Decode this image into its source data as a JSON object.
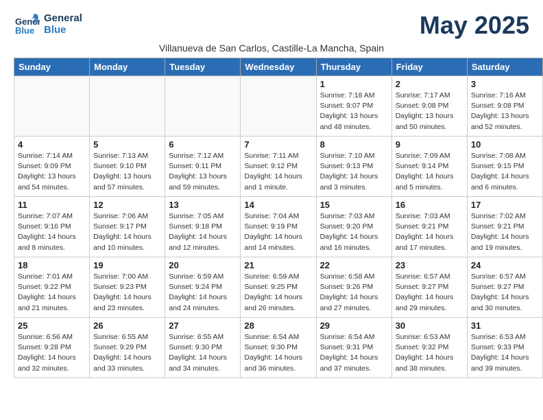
{
  "header": {
    "logo_line1": "General",
    "logo_line2": "Blue",
    "month_title": "May 2025",
    "subtitle": "Villanueva de San Carlos, Castille-La Mancha, Spain"
  },
  "days_of_week": [
    "Sunday",
    "Monday",
    "Tuesday",
    "Wednesday",
    "Thursday",
    "Friday",
    "Saturday"
  ],
  "weeks": [
    [
      {
        "day": "",
        "info": ""
      },
      {
        "day": "",
        "info": ""
      },
      {
        "day": "",
        "info": ""
      },
      {
        "day": "",
        "info": ""
      },
      {
        "day": "1",
        "info": "Sunrise: 7:18 AM\nSunset: 9:07 PM\nDaylight: 13 hours\nand 48 minutes."
      },
      {
        "day": "2",
        "info": "Sunrise: 7:17 AM\nSunset: 9:08 PM\nDaylight: 13 hours\nand 50 minutes."
      },
      {
        "day": "3",
        "info": "Sunrise: 7:16 AM\nSunset: 9:08 PM\nDaylight: 13 hours\nand 52 minutes."
      }
    ],
    [
      {
        "day": "4",
        "info": "Sunrise: 7:14 AM\nSunset: 9:09 PM\nDaylight: 13 hours\nand 54 minutes."
      },
      {
        "day": "5",
        "info": "Sunrise: 7:13 AM\nSunset: 9:10 PM\nDaylight: 13 hours\nand 57 minutes."
      },
      {
        "day": "6",
        "info": "Sunrise: 7:12 AM\nSunset: 9:11 PM\nDaylight: 13 hours\nand 59 minutes."
      },
      {
        "day": "7",
        "info": "Sunrise: 7:11 AM\nSunset: 9:12 PM\nDaylight: 14 hours\nand 1 minute."
      },
      {
        "day": "8",
        "info": "Sunrise: 7:10 AM\nSunset: 9:13 PM\nDaylight: 14 hours\nand 3 minutes."
      },
      {
        "day": "9",
        "info": "Sunrise: 7:09 AM\nSunset: 9:14 PM\nDaylight: 14 hours\nand 5 minutes."
      },
      {
        "day": "10",
        "info": "Sunrise: 7:08 AM\nSunset: 9:15 PM\nDaylight: 14 hours\nand 6 minutes."
      }
    ],
    [
      {
        "day": "11",
        "info": "Sunrise: 7:07 AM\nSunset: 9:16 PM\nDaylight: 14 hours\nand 8 minutes."
      },
      {
        "day": "12",
        "info": "Sunrise: 7:06 AM\nSunset: 9:17 PM\nDaylight: 14 hours\nand 10 minutes."
      },
      {
        "day": "13",
        "info": "Sunrise: 7:05 AM\nSunset: 9:18 PM\nDaylight: 14 hours\nand 12 minutes."
      },
      {
        "day": "14",
        "info": "Sunrise: 7:04 AM\nSunset: 9:19 PM\nDaylight: 14 hours\nand 14 minutes."
      },
      {
        "day": "15",
        "info": "Sunrise: 7:03 AM\nSunset: 9:20 PM\nDaylight: 14 hours\nand 16 minutes."
      },
      {
        "day": "16",
        "info": "Sunrise: 7:03 AM\nSunset: 9:21 PM\nDaylight: 14 hours\nand 17 minutes."
      },
      {
        "day": "17",
        "info": "Sunrise: 7:02 AM\nSunset: 9:21 PM\nDaylight: 14 hours\nand 19 minutes."
      }
    ],
    [
      {
        "day": "18",
        "info": "Sunrise: 7:01 AM\nSunset: 9:22 PM\nDaylight: 14 hours\nand 21 minutes."
      },
      {
        "day": "19",
        "info": "Sunrise: 7:00 AM\nSunset: 9:23 PM\nDaylight: 14 hours\nand 23 minutes."
      },
      {
        "day": "20",
        "info": "Sunrise: 6:59 AM\nSunset: 9:24 PM\nDaylight: 14 hours\nand 24 minutes."
      },
      {
        "day": "21",
        "info": "Sunrise: 6:59 AM\nSunset: 9:25 PM\nDaylight: 14 hours\nand 26 minutes."
      },
      {
        "day": "22",
        "info": "Sunrise: 6:58 AM\nSunset: 9:26 PM\nDaylight: 14 hours\nand 27 minutes."
      },
      {
        "day": "23",
        "info": "Sunrise: 6:57 AM\nSunset: 9:27 PM\nDaylight: 14 hours\nand 29 minutes."
      },
      {
        "day": "24",
        "info": "Sunrise: 6:57 AM\nSunset: 9:27 PM\nDaylight: 14 hours\nand 30 minutes."
      }
    ],
    [
      {
        "day": "25",
        "info": "Sunrise: 6:56 AM\nSunset: 9:28 PM\nDaylight: 14 hours\nand 32 minutes."
      },
      {
        "day": "26",
        "info": "Sunrise: 6:55 AM\nSunset: 9:29 PM\nDaylight: 14 hours\nand 33 minutes."
      },
      {
        "day": "27",
        "info": "Sunrise: 6:55 AM\nSunset: 9:30 PM\nDaylight: 14 hours\nand 34 minutes."
      },
      {
        "day": "28",
        "info": "Sunrise: 6:54 AM\nSunset: 9:30 PM\nDaylight: 14 hours\nand 36 minutes."
      },
      {
        "day": "29",
        "info": "Sunrise: 6:54 AM\nSunset: 9:31 PM\nDaylight: 14 hours\nand 37 minutes."
      },
      {
        "day": "30",
        "info": "Sunrise: 6:53 AM\nSunset: 9:32 PM\nDaylight: 14 hours\nand 38 minutes."
      },
      {
        "day": "31",
        "info": "Sunrise: 6:53 AM\nSunset: 9:33 PM\nDaylight: 14 hours\nand 39 minutes."
      }
    ]
  ]
}
